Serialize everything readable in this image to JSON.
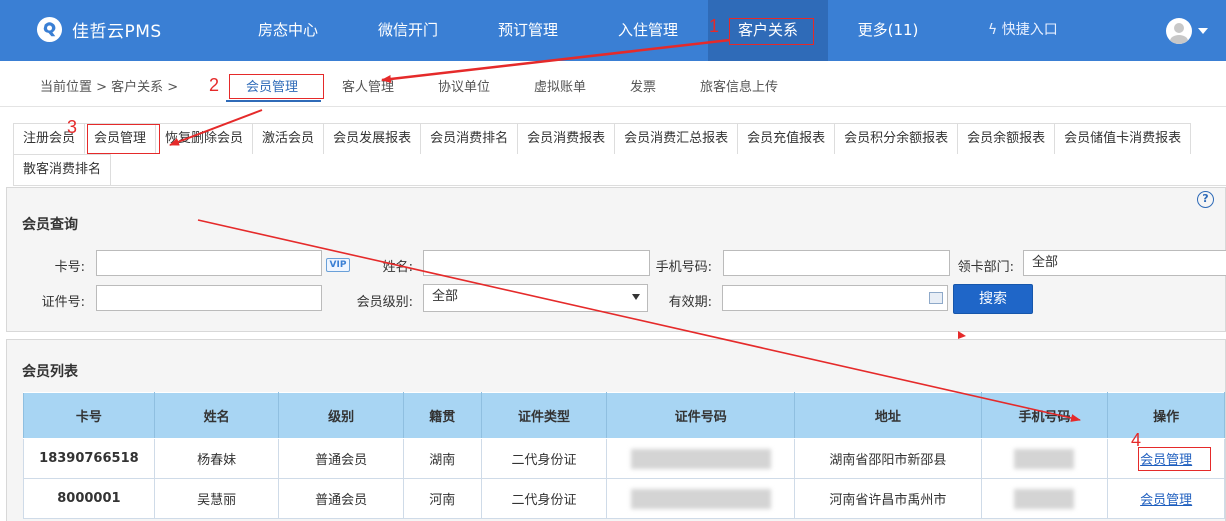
{
  "app": {
    "name": "佳哲云PMS"
  },
  "nav": {
    "items": [
      {
        "label": "房态中心"
      },
      {
        "label": "微信开门"
      },
      {
        "label": "预订管理"
      },
      {
        "label": "入住管理"
      },
      {
        "label": "客户关系"
      },
      {
        "label": "更多(11)"
      }
    ],
    "active": "客户关系",
    "quick_entry": "快捷入口"
  },
  "breadcrumb": {
    "text": "当前位置 > 客户关系 >"
  },
  "subnav": {
    "items": [
      {
        "label": "会员管理"
      },
      {
        "label": "客人管理"
      },
      {
        "label": "协议单位"
      },
      {
        "label": "虚拟账单"
      },
      {
        "label": "发票"
      },
      {
        "label": "旅客信息上传"
      }
    ],
    "active": "会员管理"
  },
  "tabs": {
    "row1": [
      "注册会员",
      "会员管理",
      "恢复删除会员",
      "激活会员",
      "会员发展报表",
      "会员消费排名",
      "会员消费报表",
      "会员消费汇总报表",
      "会员充值报表",
      "会员积分余额报表",
      "会员余额报表",
      "会员储值卡消费报表"
    ],
    "row2": [
      "散客消费排名"
    ],
    "active": "会员管理"
  },
  "query": {
    "title": "会员查询",
    "help_label": "?",
    "card_label": "卡号:",
    "card_value": "",
    "vip_label": "VIP",
    "name_label": "姓名:",
    "name_value": "",
    "phone_label": "手机号码:",
    "phone_value": "",
    "dept_label": "领卡部门:",
    "dept_value": "全部",
    "id_label": "证件号:",
    "id_value": "",
    "level_label": "会员级别:",
    "level_value": "全部",
    "valid_label": "有效期:",
    "valid_value": "",
    "search_button": "搜索"
  },
  "list": {
    "title": "会员列表",
    "columns": [
      "卡号",
      "姓名",
      "级别",
      "籍贯",
      "证件类型",
      "证件号码",
      "地址",
      "手机号码",
      "操作"
    ],
    "rows": [
      {
        "card": "18390766518",
        "name": "杨春妹",
        "level": "普通会员",
        "origin": "湖南",
        "id_type": "二代身份证",
        "address": "湖南省邵阳市新邵县",
        "action": "会员管理"
      },
      {
        "card": "8000001",
        "name": "吴慧丽",
        "level": "普通会员",
        "origin": "河南",
        "id_type": "二代身份证",
        "address": "河南省许昌市禹州市",
        "action": "会员管理"
      }
    ]
  },
  "annotations": {
    "n1": "1",
    "n2": "2",
    "n3": "3",
    "n4": "4"
  },
  "colors": {
    "topbar": "#3a7fd4",
    "topbar_active": "#2f6bb8",
    "accent": "#2f6bb8",
    "annotation": "#e52a2a",
    "table_header": "#a8d5f3",
    "search_button": "#1f66c8"
  }
}
